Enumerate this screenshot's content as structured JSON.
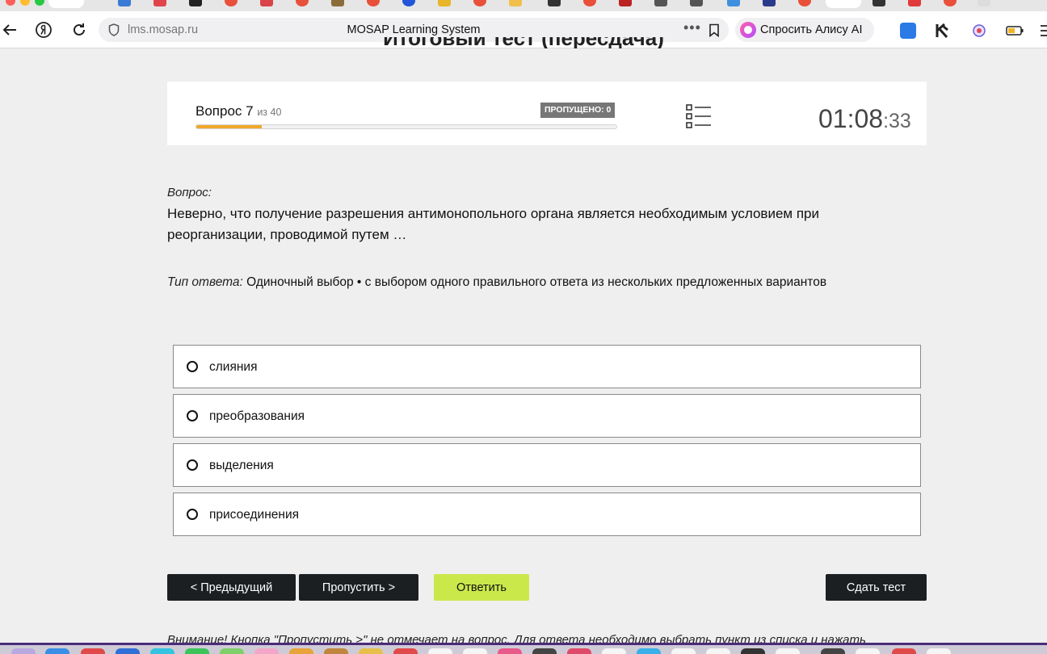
{
  "browser": {
    "url": "lms.mosap.ru",
    "page_title": "MOSAP Learning System",
    "alice_label": "Спросить Алису AI",
    "more_label": "•••"
  },
  "page": {
    "heading": "Итоговый тест (пересдача)"
  },
  "status": {
    "question_label": "Вопрос 7",
    "question_of": "из 40",
    "skipped_badge": "ПРОПУЩЕНО: 0",
    "progress_fraction": 0.155,
    "timer_main": "01:08",
    "timer_sep": ":",
    "timer_seconds": "33"
  },
  "question": {
    "caption": "Вопрос:",
    "text": "Неверно, что получение разрешения антимонопольного органа является необходимым условием при реорганизации, проводимой путем …",
    "answer_type_caption": "Тип ответа:",
    "answer_type": "Одиночный выбор • с выбором одного правильного ответа из нескольких предложенных вариантов",
    "options": [
      {
        "label": "слияния"
      },
      {
        "label": "преобразования"
      },
      {
        "label": "выделения"
      },
      {
        "label": "присоединения"
      }
    ]
  },
  "buttons": {
    "prev": "< Предыдущий",
    "skip": "Пропустить >",
    "answer": "Ответить",
    "finish": "Сдать тест"
  },
  "notice": "Внимание! Кнопка \"Пропустить >\" не отмечает на вопрос. Для ответа необходимо выбрать пункт из списка и нажать",
  "colors": {
    "accent_answer": "#cbe84b",
    "progress": "#f0a72c",
    "dark_button": "#1b1f22"
  }
}
